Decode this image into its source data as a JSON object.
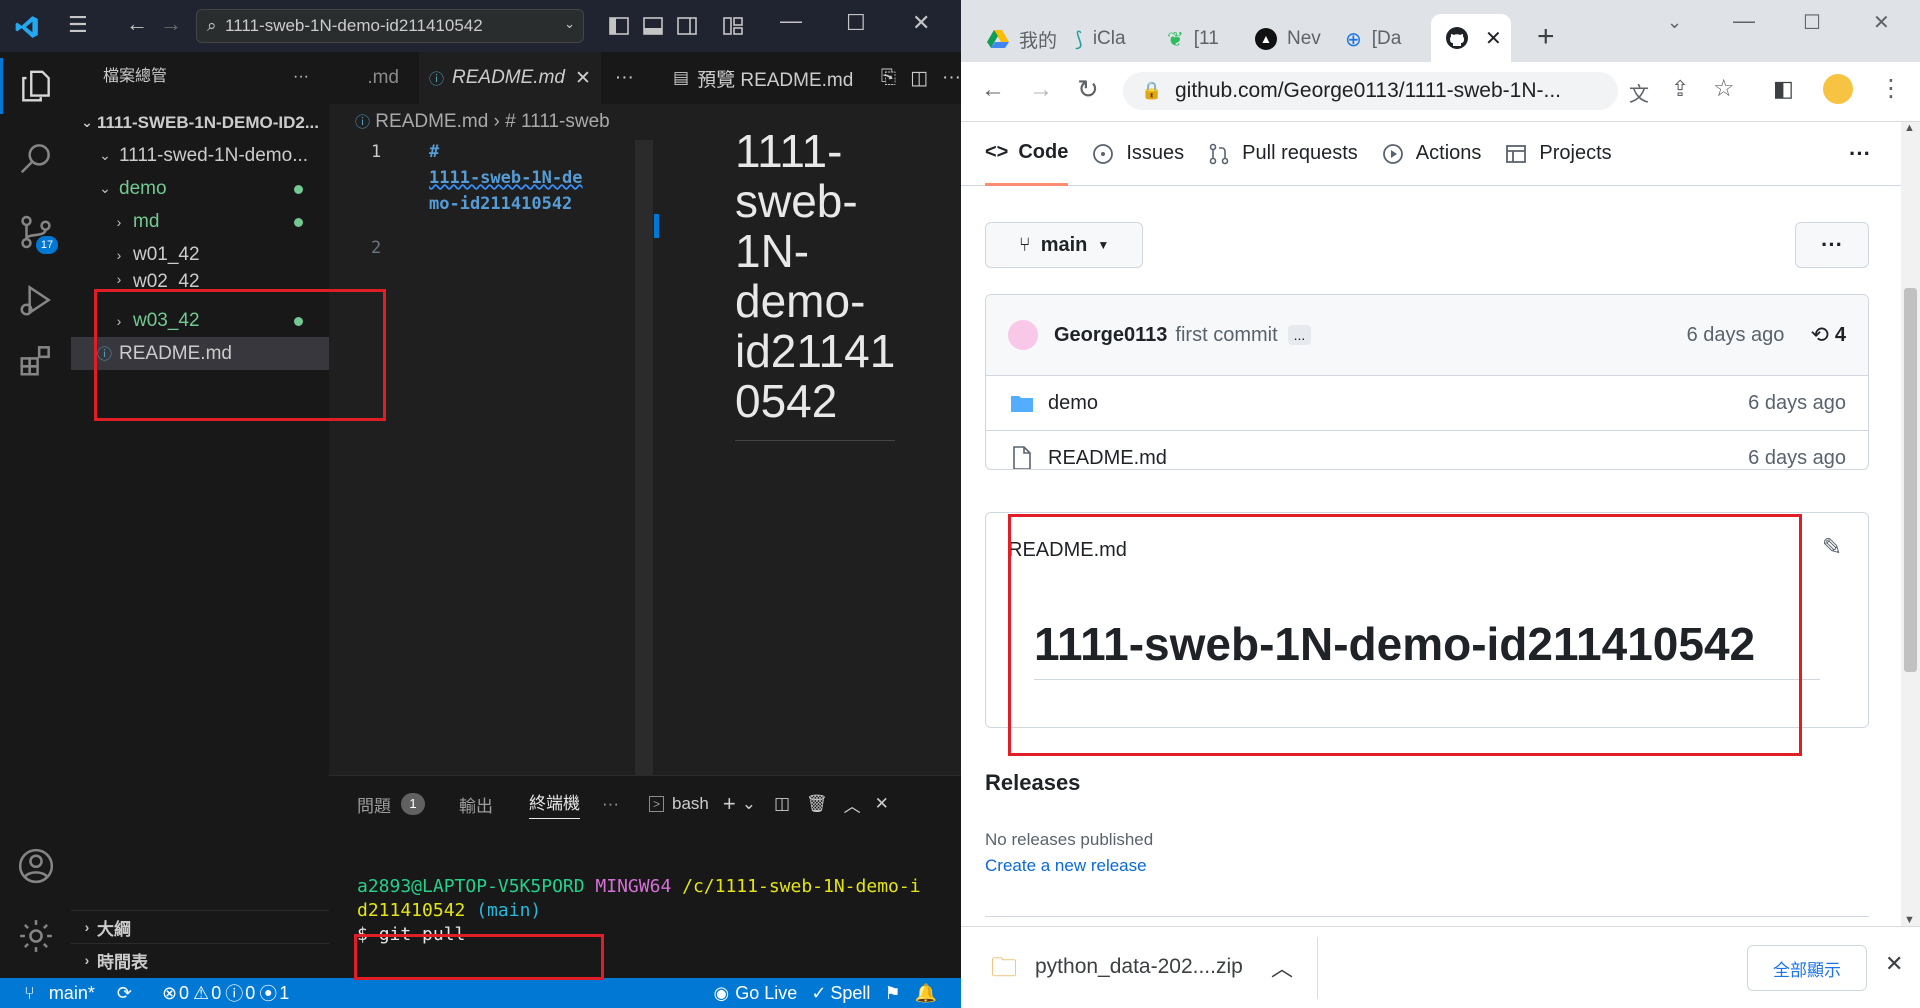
{
  "vscode": {
    "title_search": "1111-sweb-1N-demo-id211410542",
    "scm_badge": "17",
    "explorer": {
      "header": "檔案總管",
      "more": "···",
      "root": "1111-SWEB-1N-DEMO-ID2...",
      "items": [
        {
          "label": "1111-swed-1N-demo..."
        },
        {
          "label": "demo"
        },
        {
          "label": "md"
        },
        {
          "label": "w01_42"
        },
        {
          "label": "w02_42"
        },
        {
          "label": "w03_42"
        },
        {
          "label": "README.md"
        }
      ],
      "outline": "大綱",
      "timeline": "時間表"
    },
    "editor": {
      "tab_prev": ".md",
      "tab_active": "README.md",
      "more": "···",
      "breadcrumb_file": "README.md",
      "breadcrumb_symbol": "# 1111-sweb",
      "line1": "1",
      "line2": "2",
      "code_hash": "#",
      "code_line_a": "1111-sweb-1N-de",
      "code_line_b": "mo-id211410542"
    },
    "preview": {
      "tab": "預覽 README.md",
      "heading_lines": [
        "1111-",
        "sweb-",
        "1N-",
        "demo-",
        "id21141",
        "0542"
      ]
    },
    "panel": {
      "tab_problems": "問題",
      "problems_count": "1",
      "tab_output": "輸出",
      "tab_terminal": "終端機",
      "more": "···",
      "shell": "bash",
      "prompt_user": "a2893@LAPTOP-V5K5PORD",
      "prompt_env": "MINGW64",
      "prompt_path_a": "/c/1111-sweb-1N-demo-i",
      "prompt_path_b": "d211410542",
      "prompt_branch": "(main)",
      "prompt_symbol": "$",
      "command": "git pull"
    },
    "status": {
      "branch": "main*",
      "errors": "0",
      "warnings": "0",
      "infos": "0",
      "ports": "1",
      "golive": "Go Live",
      "spell": "Spell"
    }
  },
  "chrome": {
    "tabs": [
      "我的",
      "iCla",
      "[11",
      "Nev",
      "[Da",
      ""
    ],
    "url": "github.com/George0113/1111-sweb-1N-...",
    "download_file": "python_data-202....zip",
    "download_show_all": "全部顯示"
  },
  "github": {
    "nav": [
      "Code",
      "Issues",
      "Pull requests",
      "Actions",
      "Projects"
    ],
    "nav_more": "···",
    "branch": "main",
    "more_btn": "···",
    "commit_author": "George0113",
    "commit_message": "first commit",
    "commit_ellipsis": "...",
    "commit_time": "6 days ago",
    "commit_count": "4",
    "files": [
      {
        "name": "demo",
        "type": "folder",
        "time": "6 days ago"
      },
      {
        "name": "README.md",
        "type": "file",
        "time": "6 days ago"
      }
    ],
    "readme_title": "README.md",
    "readme_heading": "1111-sweb-1N-demo-id211410542",
    "releases_title": "Releases",
    "releases_none": "No releases published",
    "releases_create": "Create a new release"
  },
  "colors": {
    "annotation": "#e11e26",
    "vscode_accent": "#0078d4",
    "git_untracked": "#73c991"
  }
}
